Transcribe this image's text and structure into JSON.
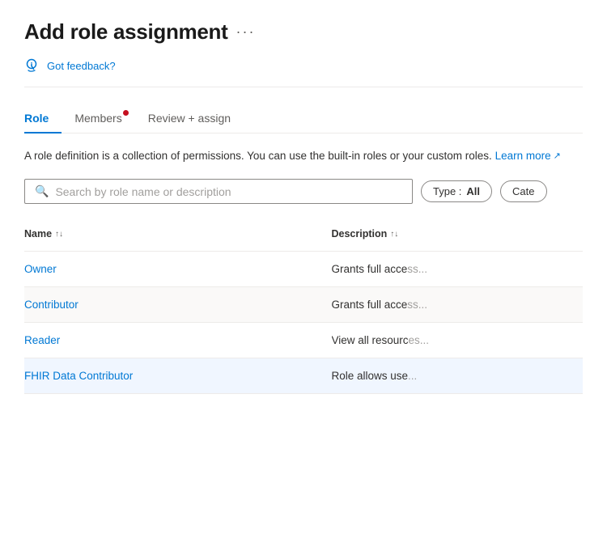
{
  "header": {
    "title": "Add role assignment",
    "more_label": "···"
  },
  "feedback": {
    "label": "Got feedback?"
  },
  "tabs": [
    {
      "id": "role",
      "label": "Role",
      "active": true,
      "has_dot": false
    },
    {
      "id": "members",
      "label": "Members",
      "active": false,
      "has_dot": true
    },
    {
      "id": "review",
      "label": "Review + assign",
      "active": false,
      "has_dot": false
    }
  ],
  "description": {
    "main": "A role definition is a collection of permissions. You can use the built-in roles or yo",
    "main_full": "A role definition is a collection of permissions. You can use the built-in roles or your custom roles.",
    "learn_more": "Learn more"
  },
  "search": {
    "placeholder": "Search by role name or description"
  },
  "type_filter": {
    "label": "Type : ",
    "value": "All"
  },
  "cate_filter": {
    "label": "Cate"
  },
  "table": {
    "columns": [
      {
        "id": "name",
        "label": "Name",
        "sort": "↑↓"
      },
      {
        "id": "description",
        "label": "Description",
        "sort": "↑↓"
      }
    ],
    "rows": [
      {
        "id": "owner",
        "name": "Owner",
        "description": "Grants full acce",
        "highlighted": false,
        "alt": false
      },
      {
        "id": "contributor",
        "name": "Contributor",
        "description": "Grants full acce",
        "highlighted": false,
        "alt": true
      },
      {
        "id": "reader",
        "name": "Reader",
        "description": "View all resourc",
        "highlighted": false,
        "alt": false
      },
      {
        "id": "fhir-data-contributor",
        "name": "FHIR Data Contributor",
        "description": "Role allows use",
        "highlighted": true,
        "alt": false
      }
    ]
  }
}
